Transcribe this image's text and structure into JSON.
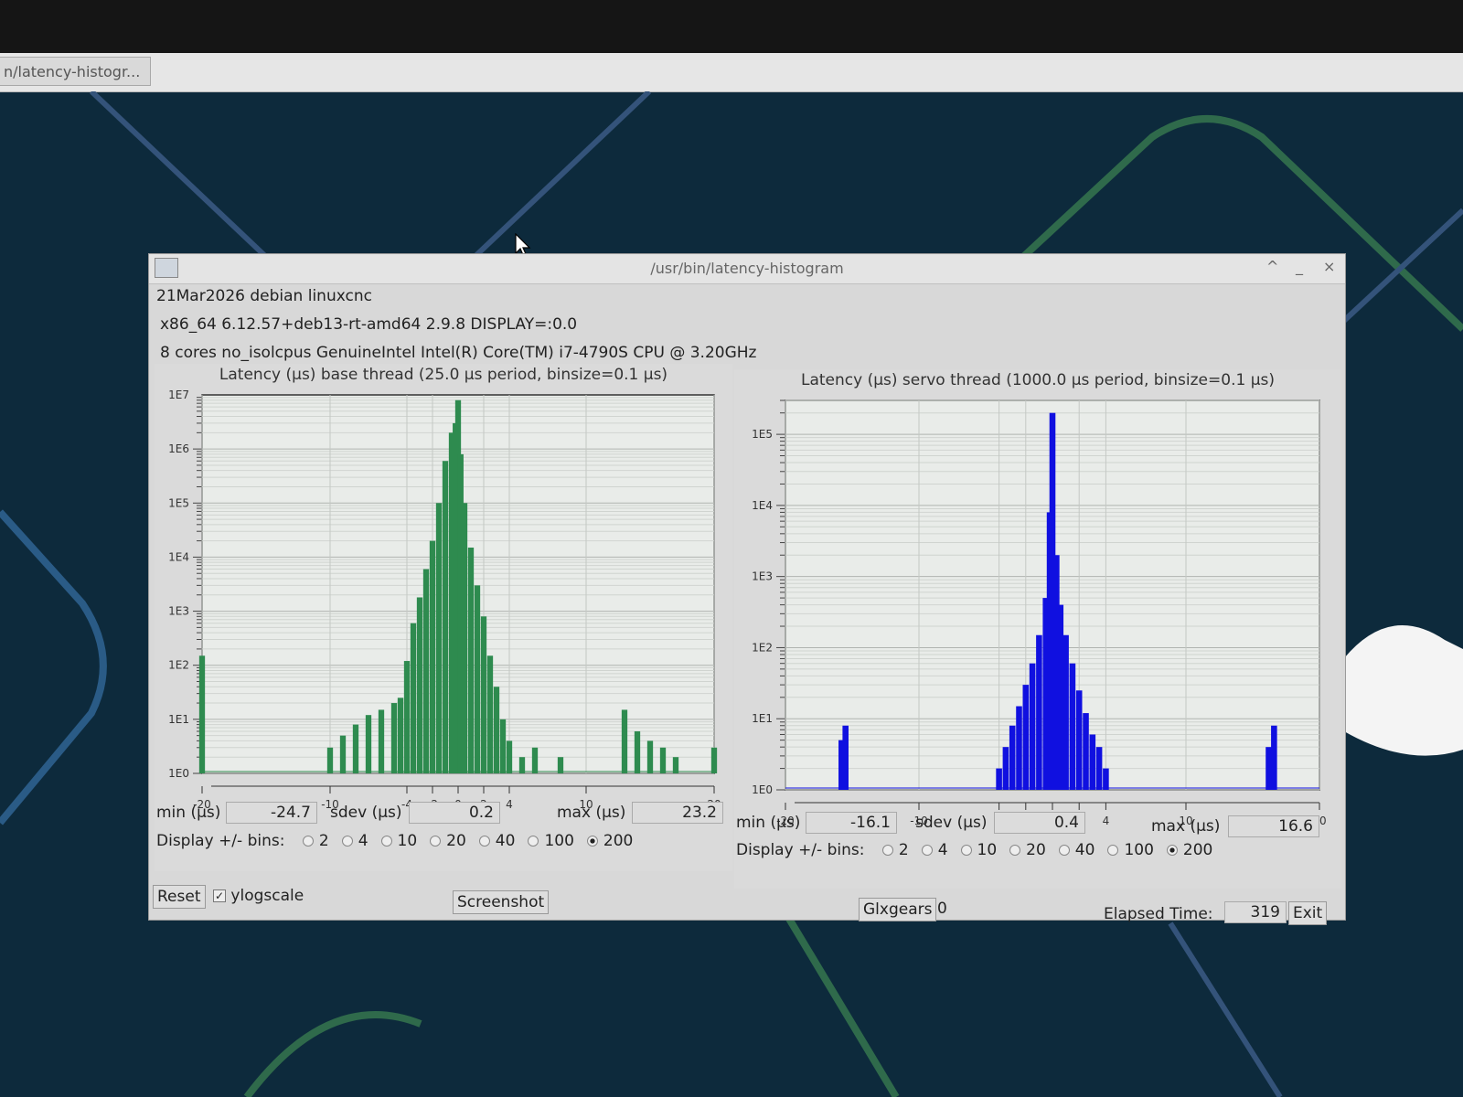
{
  "taskbar": {
    "task_label": "n/latency-histogr..."
  },
  "window": {
    "title": "/usr/bin/latency-histogram",
    "controls": {
      "maximize": "^",
      "minimize": "_",
      "close": "×"
    },
    "info_line1": "21Mar2026 debian linuxcnc",
    "info_line2": "x86_64  6.12.57+deb13-rt-amd64  2.9.8  DISPLAY=:0.0",
    "info_line3": "8 cores  no_isolcpus   GenuineIntel  Intel(R) Core(TM) i7-4790S CPU @ 3.20GHz"
  },
  "base": {
    "title": "Latency (µs) base thread (25.0 µs period, binsize=0.1 µs)",
    "min_label": "min (µs)",
    "min_value": "-24.7",
    "sdev_label": "sdev (µs)",
    "sdev_value": "0.2",
    "max_label": "max (µs)",
    "max_value": "23.2",
    "bins_label": "Display +/- bins:",
    "bins_options": [
      "2",
      "4",
      "10",
      "20",
      "40",
      "100",
      "200"
    ],
    "bins_selected": "200"
  },
  "servo": {
    "title": "Latency (µs) servo thread (1000.0 µs period, binsize=0.1 µs)",
    "min_label": "min (µs)",
    "min_value": "-16.1",
    "sdev_label": "sdev (µs)",
    "sdev_value": "0.4",
    "max_label": "max (µs)",
    "max_value": "16.6",
    "bins_label": "Display +/- bins:",
    "bins_options": [
      "2",
      "4",
      "10",
      "20",
      "40",
      "100",
      "200"
    ],
    "bins_selected": "200"
  },
  "controls": {
    "reset_label": "Reset",
    "ylogscale_label": "ylogscale",
    "ylogscale_checked": true,
    "screenshot_label": "Screenshot",
    "glxgears_label": "Glxgears",
    "glxgears_value": "0",
    "elapsed_label": "Elapsed Time:",
    "elapsed_value": "319",
    "exit_label": "Exit"
  },
  "colors": {
    "base_bars": "#2e8b4f",
    "servo_bars": "#1010e0",
    "plot_bg": "#e9ece9"
  },
  "chart_data": [
    {
      "type": "bar",
      "title": "Latency (µs) base thread (25.0 µs period, binsize=0.1 µs)",
      "xlim": [
        -20,
        20
      ],
      "x_ticks": [
        -20,
        -10,
        -4,
        -2,
        0,
        2,
        4,
        10,
        20
      ],
      "y_scale": "log",
      "y_ticks": [
        "1E0",
        "1E1",
        "1E2",
        "1E3",
        "1E4",
        "1E5",
        "1E6",
        "1E7"
      ],
      "ylim": [
        1,
        10000000
      ],
      "grid": true,
      "color": "#2e8b4f",
      "x": [
        -20,
        -19.8,
        -10,
        -9,
        -8,
        -7,
        -6,
        -5,
        -4.5,
        -4,
        -3.5,
        -3,
        -2.5,
        -2,
        -1.5,
        -1,
        -0.5,
        -0.2,
        0,
        0.2,
        0.5,
        1,
        1.5,
        2,
        2.5,
        3,
        3.5,
        4,
        5,
        6,
        8,
        13,
        14,
        15,
        16,
        17,
        20
      ],
      "values": [
        150,
        1,
        3,
        5,
        8,
        12,
        15,
        20,
        25,
        120,
        600,
        1800,
        6000,
        20000,
        100000,
        600000,
        2000000,
        3000000,
        8000000,
        800000,
        100000,
        15000,
        3000,
        800,
        150,
        40,
        10,
        4,
        2,
        3,
        2,
        15,
        6,
        4,
        3,
        2,
        3
      ]
    },
    {
      "type": "bar",
      "title": "Latency (µs) servo thread (1000.0 µs period, binsize=0.1 µs)",
      "xlim": [
        -20,
        20
      ],
      "x_ticks": [
        -20,
        -10,
        -4,
        -2,
        0,
        2,
        4,
        10,
        20
      ],
      "y_scale": "log",
      "y_ticks": [
        "1E0",
        "1E1",
        "1E2",
        "1E3",
        "1E4",
        "1E5"
      ],
      "ylim": [
        1,
        300000
      ],
      "grid": true,
      "color": "#1010e0",
      "x": [
        -15.8,
        -15.5,
        -4,
        -3.5,
        -3,
        -2.5,
        -2,
        -1.5,
        -1,
        -0.5,
        -0.2,
        0,
        0.3,
        0.6,
        1,
        1.5,
        2,
        2.5,
        3,
        3.5,
        4,
        16.2,
        16.6
      ],
      "values": [
        5,
        8,
        2,
        4,
        8,
        15,
        30,
        60,
        150,
        500,
        8000,
        200000,
        2000,
        400,
        150,
        60,
        25,
        12,
        6,
        4,
        2,
        4,
        8
      ]
    }
  ]
}
